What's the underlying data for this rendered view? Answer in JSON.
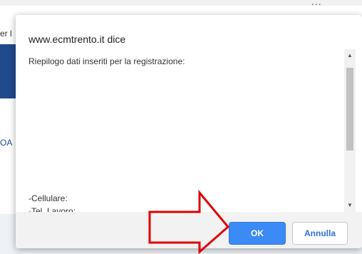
{
  "background": {
    "left_text": "er l",
    "side_text": "OA",
    "dots": "..."
  },
  "dialog": {
    "title": "www.ecmtrento.it dice",
    "message_heading": "Riepilogo dati inseriti per la registrazione:",
    "message_lines": [
      "-Cellulare:",
      "-Tel. Lavoro:"
    ],
    "ok_label": "OK",
    "cancel_label": "Annulla"
  },
  "colors": {
    "ok_button": "#3b8af6",
    "cancel_text": "#2f6fd6",
    "arrow": "#e00000",
    "background_band": "#1f4a8c"
  }
}
